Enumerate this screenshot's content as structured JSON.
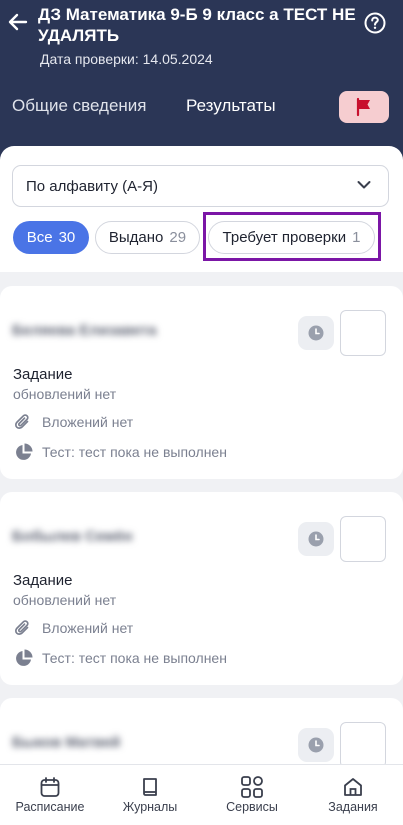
{
  "header": {
    "title": "ДЗ Математика 9-Б 9 класс а ТЕСТ НЕ УДАЛЯТЬ",
    "date_label": "Дата проверки: 14.05.2024",
    "tabs": [
      {
        "label": "Общие сведения"
      },
      {
        "label": "Результаты"
      }
    ],
    "icons": {
      "back": "back-arrow-icon",
      "help": "help-icon",
      "flag": "flag-icon"
    }
  },
  "filters": {
    "sort_value": "По алфавиту (А-Я)",
    "pills": [
      {
        "label": "Все",
        "count": "30"
      },
      {
        "label": "Выдано",
        "count": "29"
      },
      {
        "label": "Требует проверки",
        "count": "1"
      }
    ]
  },
  "students": [
    {
      "name": "Беляева Елизавета",
      "task_label": "Задание",
      "updates": "обновлений нет",
      "attachments": "Вложений нет",
      "test_status": "Тест: тест пока не выполнен"
    },
    {
      "name": "Бобылев Семён",
      "task_label": "Задание",
      "updates": "обновлений нет",
      "attachments": "Вложений нет",
      "test_status": "Тест: тест пока не выполнен"
    },
    {
      "name": "Быков Матвей"
    }
  ],
  "bottom_nav": [
    {
      "label": "Расписание",
      "icon": "calendar-icon"
    },
    {
      "label": "Журналы",
      "icon": "book-icon"
    },
    {
      "label": "Сервисы",
      "icon": "grid-icon"
    },
    {
      "label": "Задания",
      "icon": "home-icon"
    }
  ],
  "colors": {
    "header_bg": "#2b3656",
    "accent": "#4a74e6",
    "flag_bg": "#f6cdd0",
    "flag": "#c8102e",
    "highlight": "#7b16a6"
  }
}
